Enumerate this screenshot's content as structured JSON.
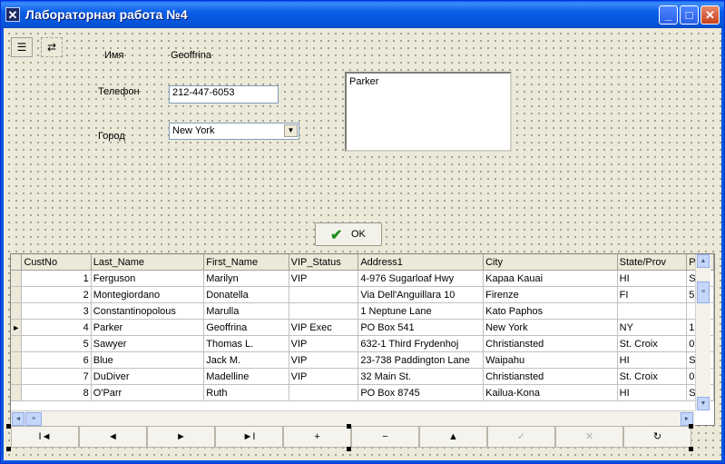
{
  "window": {
    "title": "Лабораторная работа №4",
    "icon": "app-icon",
    "controls": [
      "minimize",
      "maximize",
      "close"
    ]
  },
  "form": {
    "name_label": "Имя",
    "name_value": "Geoffrina",
    "phone_label": "Телефон",
    "phone_value": "212-447-6053",
    "city_label": "Город",
    "city_value": "New York",
    "memo_value": "Parker",
    "ok_label": "OK"
  },
  "grid": {
    "columns": [
      "CustNo",
      "Last_Name",
      "First_Name",
      "VIP_Status",
      "Address1",
      "City",
      "State/Prov",
      "P"
    ],
    "rows": [
      [
        "1",
        "Ferguson",
        "Marilyn",
        "VIP",
        "4-976 Sugarloaf Hwy",
        "Kapaa Kauai",
        "HI",
        "S"
      ],
      [
        "2",
        "Montegiordano",
        "Donatella",
        "",
        "Via Dell'Anguillara 10",
        "Firenze",
        "FI",
        "5"
      ],
      [
        "3",
        "Constantinopolous",
        "Marulla",
        "",
        "1 Neptune Lane",
        "Kato Paphos",
        "",
        ""
      ],
      [
        "4",
        "Parker",
        "Geoffrina",
        "VIP Exec",
        "PO Box 541",
        "New York",
        "NY",
        "1"
      ],
      [
        "5",
        "Sawyer",
        "Thomas L.",
        "VIP",
        "632-1 Third Frydenhoj",
        "Christiansted",
        "St. Croix",
        "0"
      ],
      [
        "6",
        "Blue",
        "Jack M.",
        "VIP",
        "23-738 Paddington Lane",
        "Waipahu",
        "HI",
        "S"
      ],
      [
        "7",
        "DuDiver",
        "Madelline",
        "VIP",
        "32 Main St.",
        "Christiansted",
        "St. Croix",
        "0"
      ],
      [
        "8",
        "O'Parr",
        "Ruth",
        "",
        "PO Box 8745",
        "Kailua-Kona",
        "HI",
        "S"
      ]
    ],
    "current_row": 4
  },
  "navigator": {
    "buttons": [
      {
        "name": "first",
        "glyph": "I◄",
        "enabled": true
      },
      {
        "name": "prior",
        "glyph": "◄",
        "enabled": true
      },
      {
        "name": "next",
        "glyph": "►",
        "enabled": true
      },
      {
        "name": "last",
        "glyph": "►I",
        "enabled": true
      },
      {
        "name": "insert",
        "glyph": "+",
        "enabled": true
      },
      {
        "name": "delete",
        "glyph": "−",
        "enabled": true
      },
      {
        "name": "edit",
        "glyph": "▲",
        "enabled": true
      },
      {
        "name": "post",
        "glyph": "✓",
        "enabled": false
      },
      {
        "name": "cancel",
        "glyph": "✕",
        "enabled": false
      },
      {
        "name": "refresh",
        "glyph": "↻",
        "enabled": true
      }
    ]
  },
  "colors": {
    "titlebar": "#0a5fe8",
    "form_bg": "#ece9d8",
    "ok_check": "#1f8f1f"
  }
}
